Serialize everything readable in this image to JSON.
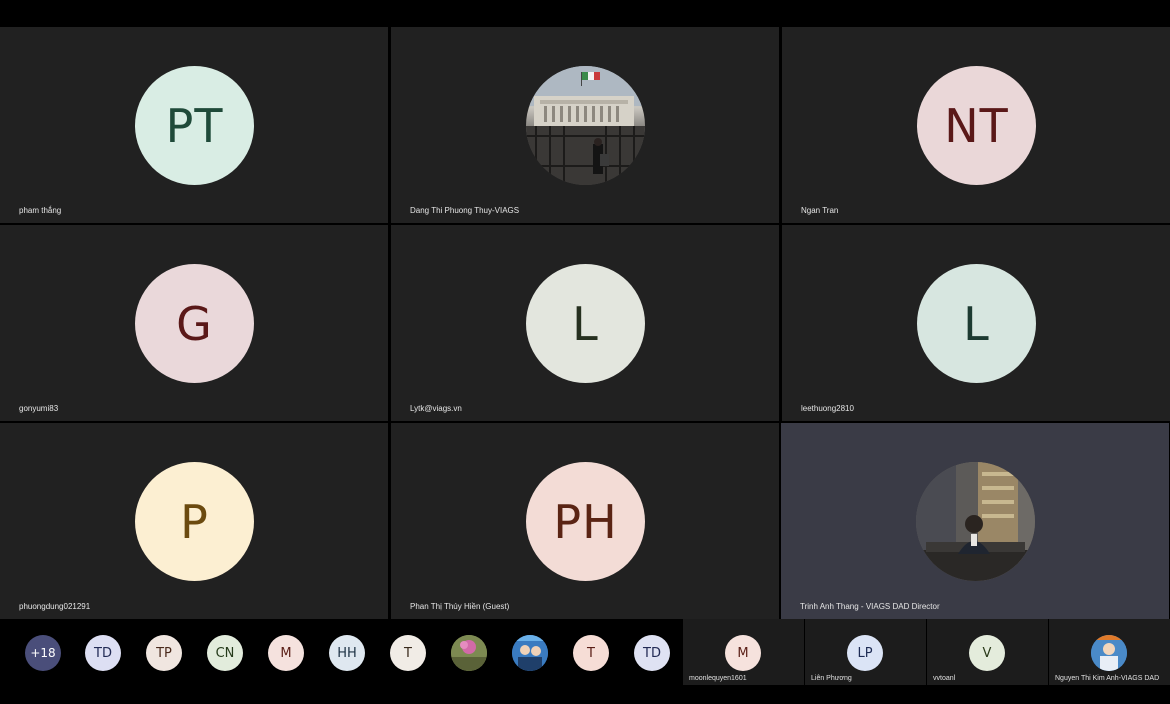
{
  "tiles": [
    {
      "initials": "PT",
      "name": "pham thắng",
      "bg": "#d9ede4",
      "fg": "#1f4a39",
      "type": "initials"
    },
    {
      "initials": "",
      "name": "Dang Thi Phuong Thuy-VIAGS",
      "bg": "#b7b7b7",
      "fg": "#000000",
      "type": "photo"
    },
    {
      "initials": "NT",
      "name": "Ngan Tran",
      "bg": "#ead7d8",
      "fg": "#5a1818",
      "type": "initials"
    },
    {
      "initials": "G",
      "name": "gonyumi83",
      "bg": "#ead8da",
      "fg": "#5a1818",
      "type": "initials"
    },
    {
      "initials": "L",
      "name": "Lytk@viags.vn",
      "bg": "#e3e6de",
      "fg": "#26301f",
      "type": "initials"
    },
    {
      "initials": "L",
      "name": "leethuong2810",
      "bg": "#d7e6e0",
      "fg": "#1c3a31",
      "type": "initials"
    },
    {
      "initials": "P",
      "name": "phuongdung021291",
      "bg": "#fcefd2",
      "fg": "#6b4a0f",
      "type": "initials"
    },
    {
      "initials": "PH",
      "name": "Phan Thị Thúy Hiền (Guest)",
      "bg": "#f3dcd6",
      "fg": "#5a2414",
      "type": "initials"
    },
    {
      "initials": "",
      "name": "Trinh Anh Thang - VIAGS DAD Director",
      "bg": "#6a6560",
      "fg": "#000000",
      "type": "photo"
    }
  ],
  "overflow": {
    "label": "+18",
    "bg": "#4a4e7a",
    "fg": "#ffffff"
  },
  "strip_avatars": [
    {
      "initials": "TD",
      "bg": "#dddff3",
      "fg": "#222a55"
    },
    {
      "initials": "TP",
      "bg": "#f0e6e0",
      "fg": "#4a2a1c"
    },
    {
      "initials": "CN",
      "bg": "#e2ecdc",
      "fg": "#243a1a"
    },
    {
      "initials": "M",
      "bg": "#f5e2de",
      "fg": "#5a1e16"
    },
    {
      "initials": "HH",
      "bg": "#dfe8f0",
      "fg": "#1d3244"
    },
    {
      "initials": "T",
      "bg": "#f1ece6",
      "fg": "#3a2a1c"
    },
    {
      "initials": "",
      "bg": "#8a9a5a",
      "fg": "#000000"
    },
    {
      "initials": "",
      "bg": "#3a7bc0",
      "fg": "#000000"
    },
    {
      "initials": "T",
      "bg": "#f6ddd6",
      "fg": "#5a1e16"
    },
    {
      "initials": "TD",
      "bg": "#dfe2f3",
      "fg": "#222a55"
    }
  ],
  "strip_named": [
    {
      "initials": "M",
      "name": "moonlequyen1601",
      "bg": "#f6e2dd",
      "fg": "#5a1e16"
    },
    {
      "initials": "LP",
      "name": "Liên Phương",
      "bg": "#dbe4f6",
      "fg": "#1e2c55"
    },
    {
      "initials": "V",
      "name": "vvtoanl",
      "bg": "#e4ecdc",
      "fg": "#2a3a1a"
    },
    {
      "initials": "",
      "name": "Nguyen Thi Kim Anh-VIAGS DAD",
      "bg": "#4a8ac8",
      "fg": "#000000"
    }
  ]
}
